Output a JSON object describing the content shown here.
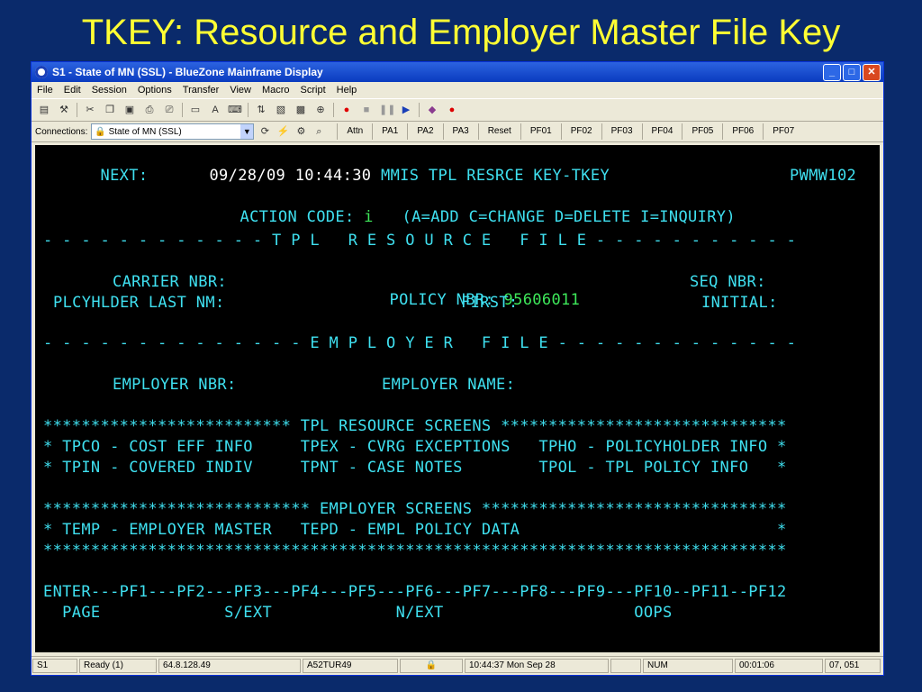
{
  "slide": {
    "title": "TKEY: Resource and Employer Master File Key"
  },
  "window": {
    "title": "S1 - State of MN (SSL) - BlueZone Mainframe Display",
    "buttons": {
      "minimize": "_",
      "maximize": "□",
      "close": "✕"
    }
  },
  "menu": [
    "File",
    "Edit",
    "Session",
    "Options",
    "Transfer",
    "View",
    "Macro",
    "Script",
    "Help"
  ],
  "connection": {
    "label": "Connections:",
    "value": "State of MN (SSL)"
  },
  "keys": [
    "Attn",
    "PA1",
    "PA2",
    "PA3",
    "Reset",
    "PF01",
    "PF02",
    "PF03",
    "PF04",
    "PF05",
    "PF06",
    "PF07"
  ],
  "screen": {
    "next_label": "NEXT:",
    "datetime": "09/28/09 10:44:30",
    "header": "MMIS TPL RESRCE KEY-TKEY",
    "screen_id": "PWMW102",
    "action_label": "ACTION CODE:",
    "action_value": "i",
    "action_help": "(A=ADD C=CHANGE D=DELETE I=INQUIRY)",
    "tpl_divider": "- - - - - - - - - - - - T P L   R E S O U R C E   F I L E - - - - - - - - - - -",
    "carrier_label": "CARRIER NBR:",
    "policy_label": "POLICY NBR:",
    "policy_value": "95606011",
    "seq_label": "SEQ NBR:",
    "plcy_last_label": "PLCYHLDER LAST NM:",
    "first_label": "FIRST:",
    "initial_label": "INITIAL:",
    "emp_divider": "- - - - - - - - - - - - - - E M P L O Y E R   F I L E - - - - - - - - - - - - -",
    "employer_nbr_label": "EMPLOYER NBR:",
    "employer_name_label": "EMPLOYER NAME:",
    "tpl_screens_header": "************************** TPL RESOURCE SCREENS ******************************",
    "tpl_row1": "* TPCO - COST EFF INFO     TPEX - CVRG EXCEPTIONS   TPHO - POLICYHOLDER INFO *",
    "tpl_row2": "* TPIN - COVERED INDIV     TPNT - CASE NOTES        TPOL - TPL POLICY INFO   *",
    "emp_screens_header": "**************************** EMPLOYER SCREENS ********************************",
    "emp_row1": "* TEMP - EMPLOYER MASTER   TEPD - EMPL POLICY DATA                           *",
    "stars_line": "******************************************************************************",
    "pf_line": "ENTER---PF1---PF2---PF3---PF4---PF5---PF6---PF7---PF8---PF9---PF10--PF11--PF12",
    "pf_labels": "  PAGE             S/EXT             N/EXT                    OOPS"
  },
  "status": {
    "session": "S1",
    "state": "Ready (1)",
    "ip": "64.8.128.49",
    "terminal": "A52TUR49",
    "time": "10:44:37  Mon Sep 28",
    "num": "NUM",
    "elapsed": "00:01:06",
    "cursor": "07, 051"
  }
}
